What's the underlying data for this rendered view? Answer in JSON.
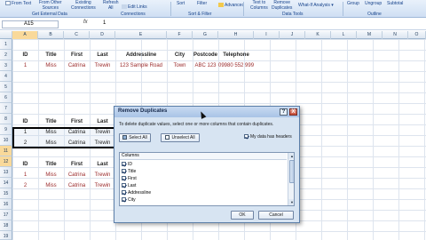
{
  "ribbon": {
    "buttons": [
      {
        "label": "From Text"
      },
      {
        "label": "From Other\nSources"
      },
      {
        "label": "Existing\nConnections"
      },
      {
        "label": "Refresh\nAll"
      },
      {
        "label": "Sort"
      },
      {
        "label": "Filter"
      },
      {
        "label": "Advanced"
      },
      {
        "label": "Text to\nColumns"
      },
      {
        "label": "Remove\nDuplicates"
      },
      {
        "label": "What-If Analysis"
      },
      {
        "label": "Group"
      },
      {
        "label": "Ungroup"
      },
      {
        "label": "Subtotal"
      }
    ],
    "edit_links": "Edit Links",
    "groups": [
      {
        "label": "Get External Data"
      },
      {
        "label": "Connections"
      },
      {
        "label": "Sort & Filter"
      },
      {
        "label": "Data Tools"
      },
      {
        "label": "Outline"
      }
    ]
  },
  "formula_bar": {
    "name_box": "A15",
    "fx": "fx",
    "value": "1"
  },
  "grid": {
    "columns": [
      "A",
      "B",
      "C",
      "D",
      "E",
      "F",
      "G",
      "H",
      "I",
      "J",
      "K",
      "L",
      "M",
      "N",
      "O",
      "P"
    ],
    "rows": [
      "1",
      "2",
      "3",
      "4",
      "5",
      "6",
      "7",
      "8",
      "9",
      "10",
      "11",
      "12",
      "13",
      "14",
      "15",
      "16",
      "17",
      "18",
      "19",
      "20"
    ]
  },
  "table_top": {
    "headers": [
      "ID",
      "Title",
      "First",
      "Last",
      "Addressline",
      "City",
      "Postcode",
      "Telephone"
    ],
    "row": [
      "1",
      "Miss",
      "Catrina",
      "Trewin",
      "123 Sample Road",
      "Town",
      "ABC 123",
      "09980 552 999"
    ]
  },
  "table_mid": {
    "headers": [
      "ID",
      "Title",
      "First",
      "Last"
    ],
    "rows": [
      [
        "1",
        "Miss",
        "Catrina",
        "Trewin"
      ],
      [
        "2",
        "Miss",
        "Catrina",
        "Trewin"
      ]
    ]
  },
  "table_bottom": {
    "headers": [
      "ID",
      "Title",
      "First",
      "Last"
    ],
    "rows": [
      [
        "1",
        "Miss",
        "Catrina",
        "Trewin"
      ],
      [
        "2",
        "Miss",
        "Catrina",
        "Trewin"
      ]
    ]
  },
  "dialog": {
    "title": "Remove Duplicates",
    "help": "?",
    "close": "X",
    "description": "To delete duplicate values, select one or more columns that contain duplicates.",
    "select_all": "Select All",
    "unselect_all": "Unselect All",
    "my_data_has_headers": "My data has headers",
    "columns_header": "Columns",
    "columns": [
      {
        "label": "ID",
        "checked": true
      },
      {
        "label": "Title",
        "checked": true
      },
      {
        "label": "First",
        "checked": true
      },
      {
        "label": "Last",
        "checked": true
      },
      {
        "label": "Addressline",
        "checked": true
      },
      {
        "label": "City",
        "checked": true
      }
    ],
    "ok": "OK",
    "cancel": "Cancel"
  },
  "colors": {
    "accent": "#15428b",
    "data_red": "#9b2a2a",
    "selection": "#f9d99a"
  }
}
